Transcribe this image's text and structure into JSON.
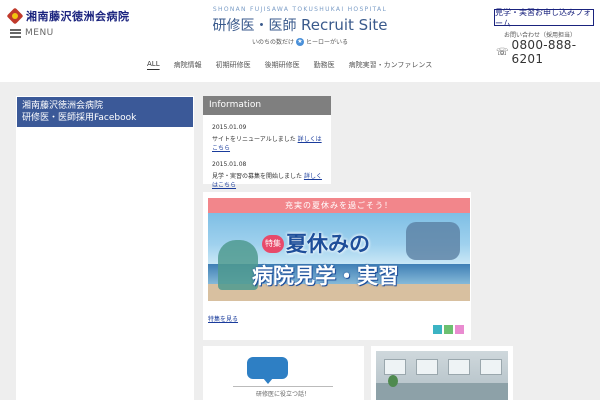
{
  "header": {
    "logo_text": "湘南藤沢徳洲会病院",
    "menu_label": "MENU",
    "site_subtitle": "SHONAN FUJISAWA TOKUSHUKAI HOSPITAL",
    "site_title_jp": "研修医・医師",
    "site_title_en": "Recruit Site",
    "tagline_left": "いのちの数だけ",
    "tagline_icon": "★",
    "tagline_right": "ヒーローがいる",
    "apply_button": "見学・実習お申し込みフォーム",
    "phone_label": "お問い合わせ（採用担当）",
    "phone_icon": "phone-icon",
    "phone_number": "0800-888-6201"
  },
  "nav": {
    "items": [
      {
        "label": "ALL"
      },
      {
        "label": "病院情報"
      },
      {
        "label": "初期研修医"
      },
      {
        "label": "後期研修医"
      },
      {
        "label": "勤務医"
      },
      {
        "label": "病院実習・カンファレンス"
      }
    ]
  },
  "facebook": {
    "line1": "湘南藤沢徳洲会病院",
    "line2": "研修医・医師採用Facebook"
  },
  "information": {
    "title": "Information",
    "items": [
      {
        "date": "2015.01.09",
        "text": "サイトをリニューアルしました",
        "link": "詳しくはこちら"
      },
      {
        "date": "2015.01.08",
        "text": "見学・実習の募集を開始しました",
        "link": "詳しくはこちら"
      }
    ]
  },
  "feature": {
    "banner": "充実の夏休みを過ごそう！",
    "badge": "特集",
    "title_line1": "夏休みの",
    "title_line2": "病院見学・実習",
    "link": "特集を見る",
    "tag_colors": [
      "#3bb3c3",
      "#6cc070",
      "#e98bd0"
    ]
  },
  "card2": {
    "text": "研修医に役立つ話！"
  }
}
